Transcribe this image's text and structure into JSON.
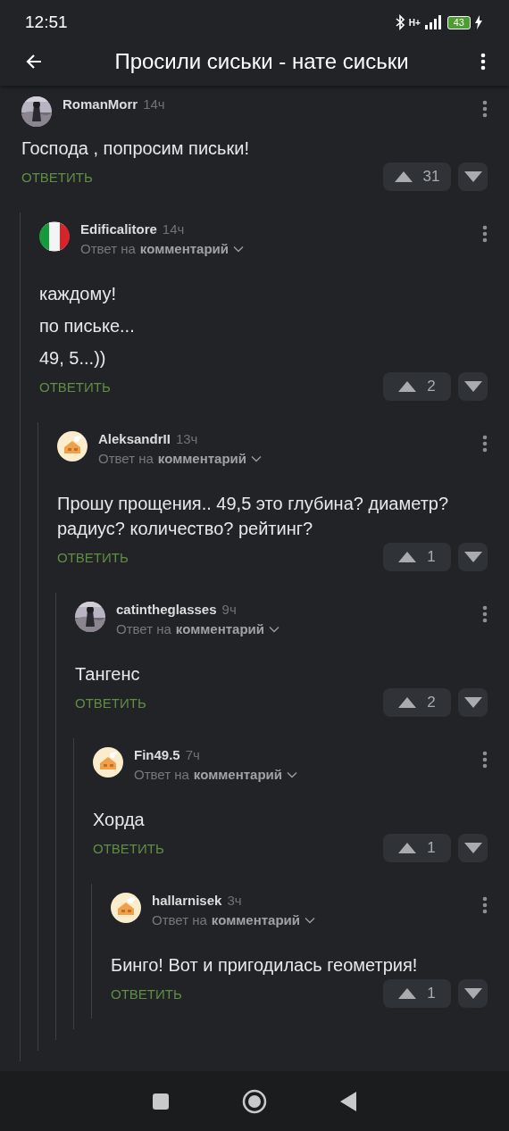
{
  "status_bar": {
    "time": "12:51",
    "network": "H+",
    "battery": "43"
  },
  "header": {
    "title": "Просили сиськи - нате сиськи"
  },
  "comments": [
    {
      "author": "RomanMorr",
      "time": "14ч",
      "text": [
        "Господа , попросим письки!"
      ],
      "reply": "ОТВЕТИТЬ",
      "score": "31",
      "children": [
        {
          "author": "Edificalitore",
          "time": "14ч",
          "avatar": {
            "kind": "flag"
          },
          "reply_to": {
            "prefix": "Ответ на",
            "link": "комментарий"
          },
          "text": [
            "каждому!",
            "по письке...",
            "49, 5...))"
          ],
          "reply": "ОТВЕТИТЬ",
          "score": "2",
          "children": [
            {
              "author": "AleksandrII",
              "time": "13ч",
              "avatar": {
                "kind": "house"
              },
              "reply_to": {
                "prefix": "Ответ на",
                "link": "комментарий"
              },
              "text": [
                "Прошу прощения.. 49,5 это глубина? диаметр? радиус? количество? рейтинг?"
              ],
              "reply": "ОТВЕТИТЬ",
              "score": "1",
              "children": [
                {
                  "author": "catintheglasses",
                  "time": "9ч",
                  "reply_to": {
                    "prefix": "Ответ на",
                    "link": "комментарий"
                  },
                  "text": [
                    "Тангенс"
                  ],
                  "reply": "ОТВЕТИТЬ",
                  "score": "2",
                  "children": [
                    {
                      "author": "Fin49.5",
                      "time": "7ч",
                      "avatar": {
                        "kind": "house"
                      },
                      "reply_to": {
                        "prefix": "Ответ на",
                        "link": "комментарий"
                      },
                      "text": [
                        "Хорда"
                      ],
                      "reply": "ОТВЕТИТЬ",
                      "score": "1",
                      "children": [
                        {
                          "author": "hallarnisek",
                          "time": "3ч",
                          "avatar": {
                            "kind": "house"
                          },
                          "reply_to": {
                            "prefix": "Ответ на",
                            "link": "комментарий"
                          },
                          "text": [
                            "Бинго! Вот и пригодилась геометрия!"
                          ],
                          "reply": "ОТВЕТИТЬ",
                          "score": "1"
                        }
                      ]
                    }
                  ]
                }
              ]
            }
          ]
        }
      ]
    }
  ]
}
